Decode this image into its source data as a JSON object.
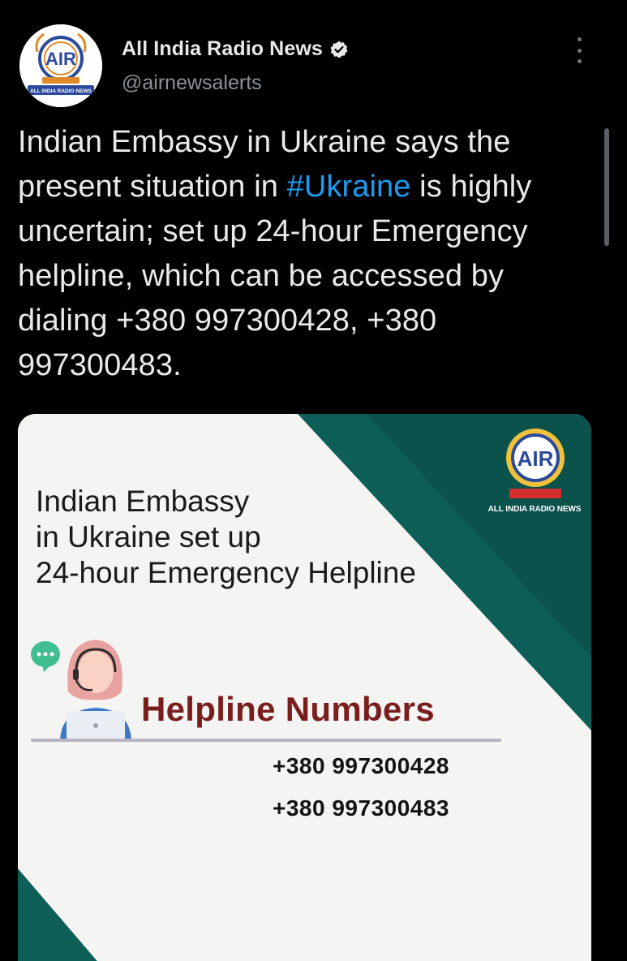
{
  "account": {
    "display_name": "All India Radio News",
    "handle": "@airnewsalerts",
    "verified": true,
    "avatar_icon": "air-logo-icon",
    "avatar_caption": "ALL INDIA RADIO NEWS"
  },
  "tweet": {
    "text_before_hashtag": "Indian Embassy in Ukraine says the present situation in ",
    "hashtag": "#Ukraine",
    "text_after_hashtag": " is highly uncertain; set up 24-hour Emergency helpline, which can be accessed by dialing +380 997300428, +380 997300483."
  },
  "media": {
    "title_lines": [
      "Indian Embassy",
      "in Ukraine set up",
      "24-hour Emergency Helpline"
    ],
    "logo_caption": "ALL INDIA RADIO NEWS",
    "helpline_heading": "Helpline Numbers",
    "phone_numbers": [
      "+380 997300428",
      "+380 997300483"
    ]
  },
  "colors": {
    "background": "#000000",
    "text_primary": "#e7e9ea",
    "text_secondary": "#8b9196",
    "hashtag": "#1d9bf0",
    "card_teal": "#0e5e58",
    "heading_maroon": "#7a1d1d"
  }
}
